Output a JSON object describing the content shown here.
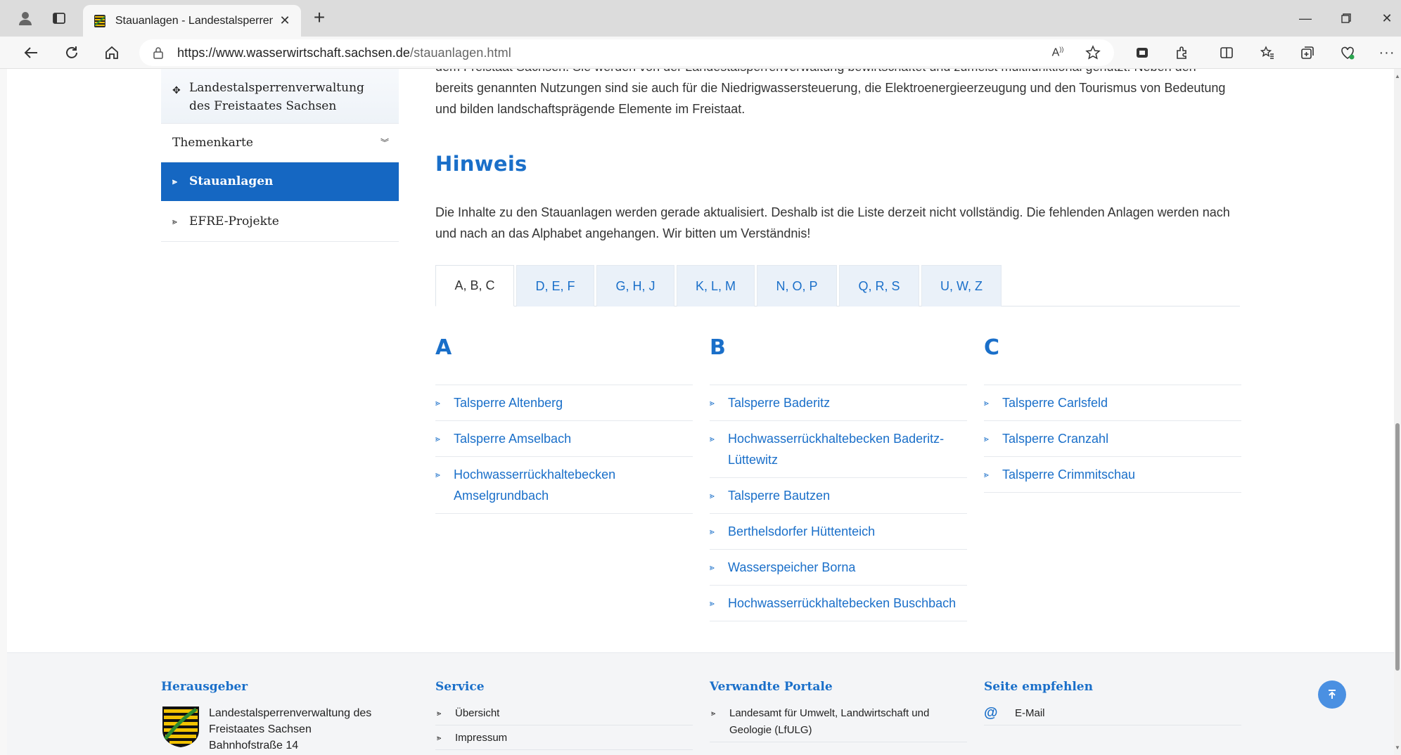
{
  "browser": {
    "tab_title": "Stauanlagen - Landestalsperrenv",
    "address_base": "https://www.wasserwirtschaft.sachsen.de",
    "address_path": "/stauanlagen.html"
  },
  "sidebar": {
    "parent": "Landestalsperrenverwaltung des Freistaates Sachsen",
    "themenkarte": "Themenkarte",
    "active": "Stauanlagen",
    "efre": "EFRE-Projekte"
  },
  "main": {
    "intro_line1": "dem Freistaat Sachsen. Sie werden von der Landestalsperrenverwaltung bewirtschaftet und zumeist multifunktional genutzt. Neben den",
    "intro_line2": "bereits genannten Nutzungen sind sie auch für die Niedrigwassersteuerung, die Elektroenergieerzeugung und den Tourismus von Bedeutung",
    "intro_line3": "und bilden landschaftsprägende Elemente im Freistaat.",
    "hint_title": "Hinweis",
    "hint_text": "Die Inhalte zu den Stauanlagen werden gerade aktualisiert. Deshalb ist die Liste derzeit nicht vollständig. Die fehlenden Anlagen werden nach und nach an das Alphabet angehangen. Wir bitten um Verständnis!",
    "tabs": [
      "A, B, C",
      "D, E, F",
      "G, H, J",
      "K, L, M",
      "N, O, P",
      "Q, R, S",
      "U, W, Z"
    ],
    "columns": [
      {
        "letter": "A",
        "items": [
          "Talsperre Altenberg",
          "Talsperre Amselbach",
          "Hochwasserrückhaltebecken Amselgrundbach"
        ]
      },
      {
        "letter": "B",
        "items": [
          "Talsperre Baderitz",
          "Hochwasserrückhaltebecken Baderitz-Lüttewitz",
          "Talsperre Bautzen",
          "Berthelsdorfer Hüttenteich",
          "Wasserspeicher Borna",
          "Hochwasserrückhaltebecken Buschbach"
        ]
      },
      {
        "letter": "C",
        "items": [
          "Talsperre Carlsfeld",
          "Talsperre Cranzahl",
          "Talsperre Crimmitschau"
        ]
      }
    ]
  },
  "footer": {
    "herausgeber_title": "Herausgeber",
    "herausgeber_line1": "Landestalsperrenverwaltung des",
    "herausgeber_line2": "Freistaates Sachsen",
    "herausgeber_line3": "Bahnhofstraße 14",
    "service_title": "Service",
    "service_items": [
      "Übersicht",
      "Impressum"
    ],
    "portale_title": "Verwandte Portale",
    "portale_item": "Landesamt für Umwelt, Landwirtschaft und Geologie (LfULG)",
    "empfehlen_title": "Seite empfehlen",
    "empfehlen_item": "E-Mail"
  },
  "colors": {
    "accent": "#1a6fc9",
    "active_nav": "#1567c2"
  }
}
